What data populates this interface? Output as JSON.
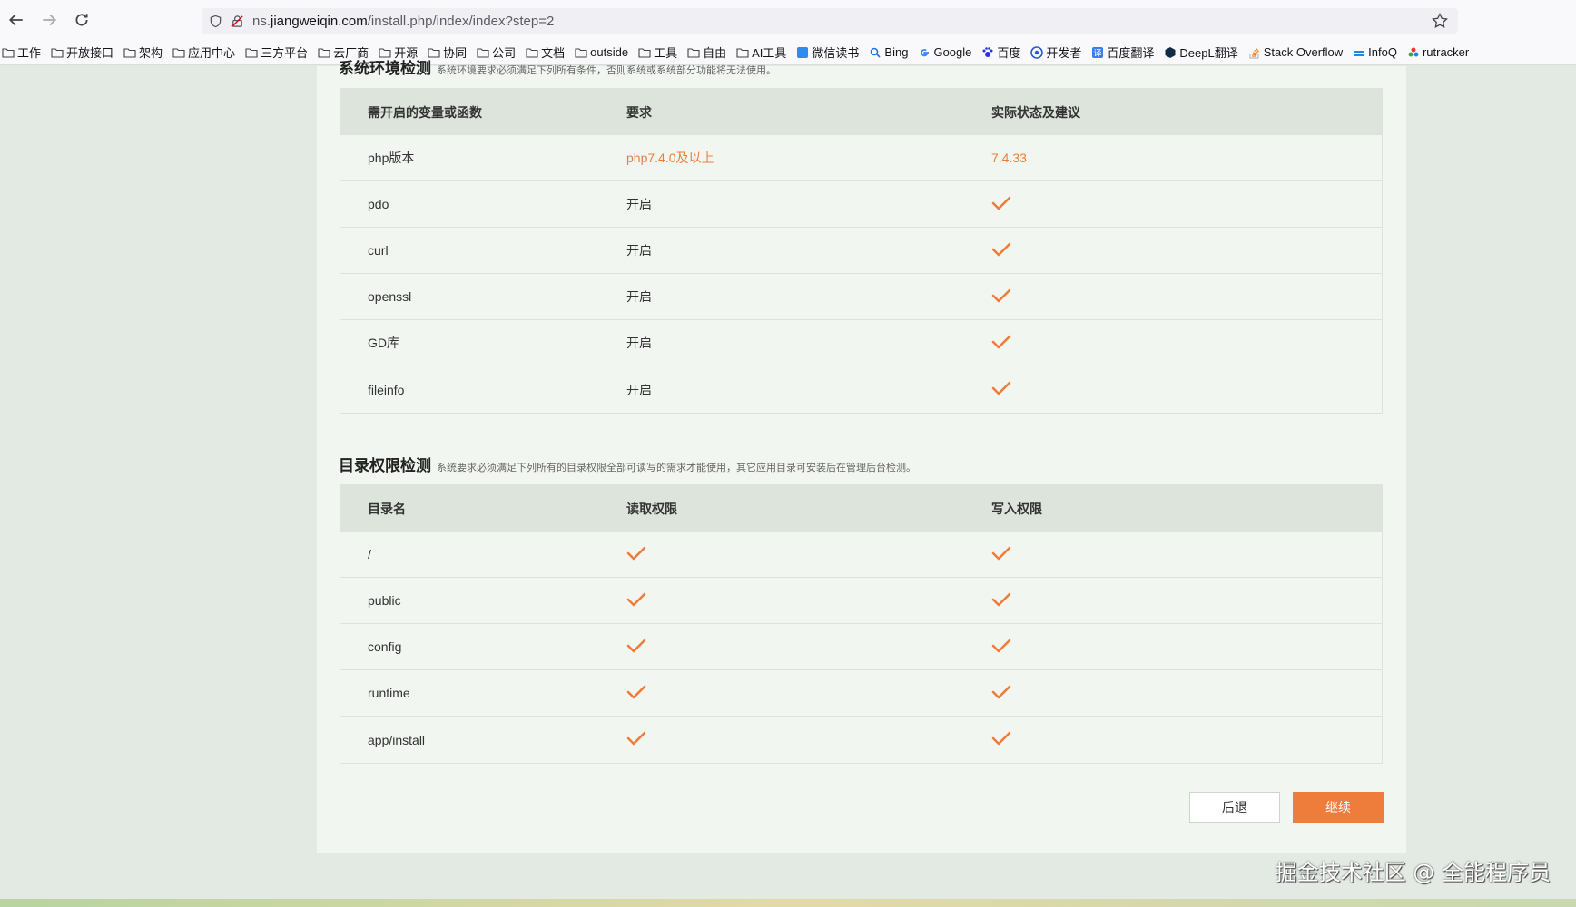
{
  "browser": {
    "url_prefix": "ns.",
    "url_host": "jiangweiqin.com",
    "url_path": "/install.php/index/index?step=2"
  },
  "bookmarks": [
    {
      "label": "工作",
      "icon": "folder-icon"
    },
    {
      "label": "开放接口",
      "icon": "folder-icon"
    },
    {
      "label": "架构",
      "icon": "folder-icon"
    },
    {
      "label": "应用中心",
      "icon": "folder-icon"
    },
    {
      "label": "三方平台",
      "icon": "folder-icon"
    },
    {
      "label": "云厂商",
      "icon": "folder-icon"
    },
    {
      "label": "开源",
      "icon": "folder-icon"
    },
    {
      "label": "协同",
      "icon": "folder-icon"
    },
    {
      "label": "公司",
      "icon": "folder-icon"
    },
    {
      "label": "文档",
      "icon": "folder-icon"
    },
    {
      "label": "outside",
      "icon": "folder-icon"
    },
    {
      "label": "工具",
      "icon": "folder-icon"
    },
    {
      "label": "自由",
      "icon": "folder-icon"
    },
    {
      "label": "AI工具",
      "icon": "folder-icon"
    },
    {
      "label": "微信读书",
      "icon": "weread-icon"
    },
    {
      "label": "Bing",
      "icon": "bing-icon"
    },
    {
      "label": "Google",
      "icon": "google-icon"
    },
    {
      "label": "百度",
      "icon": "baidu-icon"
    },
    {
      "label": "开发者",
      "icon": "developer-icon"
    },
    {
      "label": "百度翻译",
      "icon": "baidu-translate-icon"
    },
    {
      "label": "DeepL翻译",
      "icon": "deepl-icon"
    },
    {
      "label": "Stack Overflow",
      "icon": "stackoverflow-icon"
    },
    {
      "label": "InfoQ",
      "icon": "infoq-icon"
    },
    {
      "label": "rutracker",
      "icon": "rutracker-icon"
    }
  ],
  "env_section": {
    "title": "系统环境检测",
    "desc": "系统环境要求必须满足下列所有条件，否则系统或系统部分功能将无法使用。",
    "headers": [
      "需开启的变量或函数",
      "要求",
      "实际状态及建议"
    ],
    "rows": [
      {
        "name": "php版本",
        "req": "php7.4.0及以上",
        "status": "7.4.33"
      },
      {
        "name": "pdo",
        "req": "开启",
        "status": "check"
      },
      {
        "name": "curl",
        "req": "开启",
        "status": "check"
      },
      {
        "name": "openssl",
        "req": "开启",
        "status": "check"
      },
      {
        "name": "GD库",
        "req": "开启",
        "status": "check"
      },
      {
        "name": "fileinfo",
        "req": "开启",
        "status": "check"
      }
    ]
  },
  "dir_section": {
    "title": "目录权限检测",
    "desc": "系统要求必须满足下列所有的目录权限全部可读写的需求才能使用，其它应用目录可安装后在管理后台检测。",
    "headers": [
      "目录名",
      "读取权限",
      "写入权限"
    ],
    "rows": [
      {
        "name": "/",
        "read": "check",
        "write": "check"
      },
      {
        "name": "public",
        "read": "check",
        "write": "check"
      },
      {
        "name": "config",
        "read": "check",
        "write": "check"
      },
      {
        "name": "runtime",
        "read": "check",
        "write": "check"
      },
      {
        "name": "app/install",
        "read": "check",
        "write": "check"
      }
    ]
  },
  "buttons": {
    "back": "后退",
    "next": "继续"
  },
  "watermark": "掘金技术社区 @ 全能程序员",
  "colors": {
    "accent": "#ee7d3c",
    "header_bg": "#dde4dc",
    "page_bg": "#e3eae3",
    "card_bg": "#f2f6f1"
  }
}
